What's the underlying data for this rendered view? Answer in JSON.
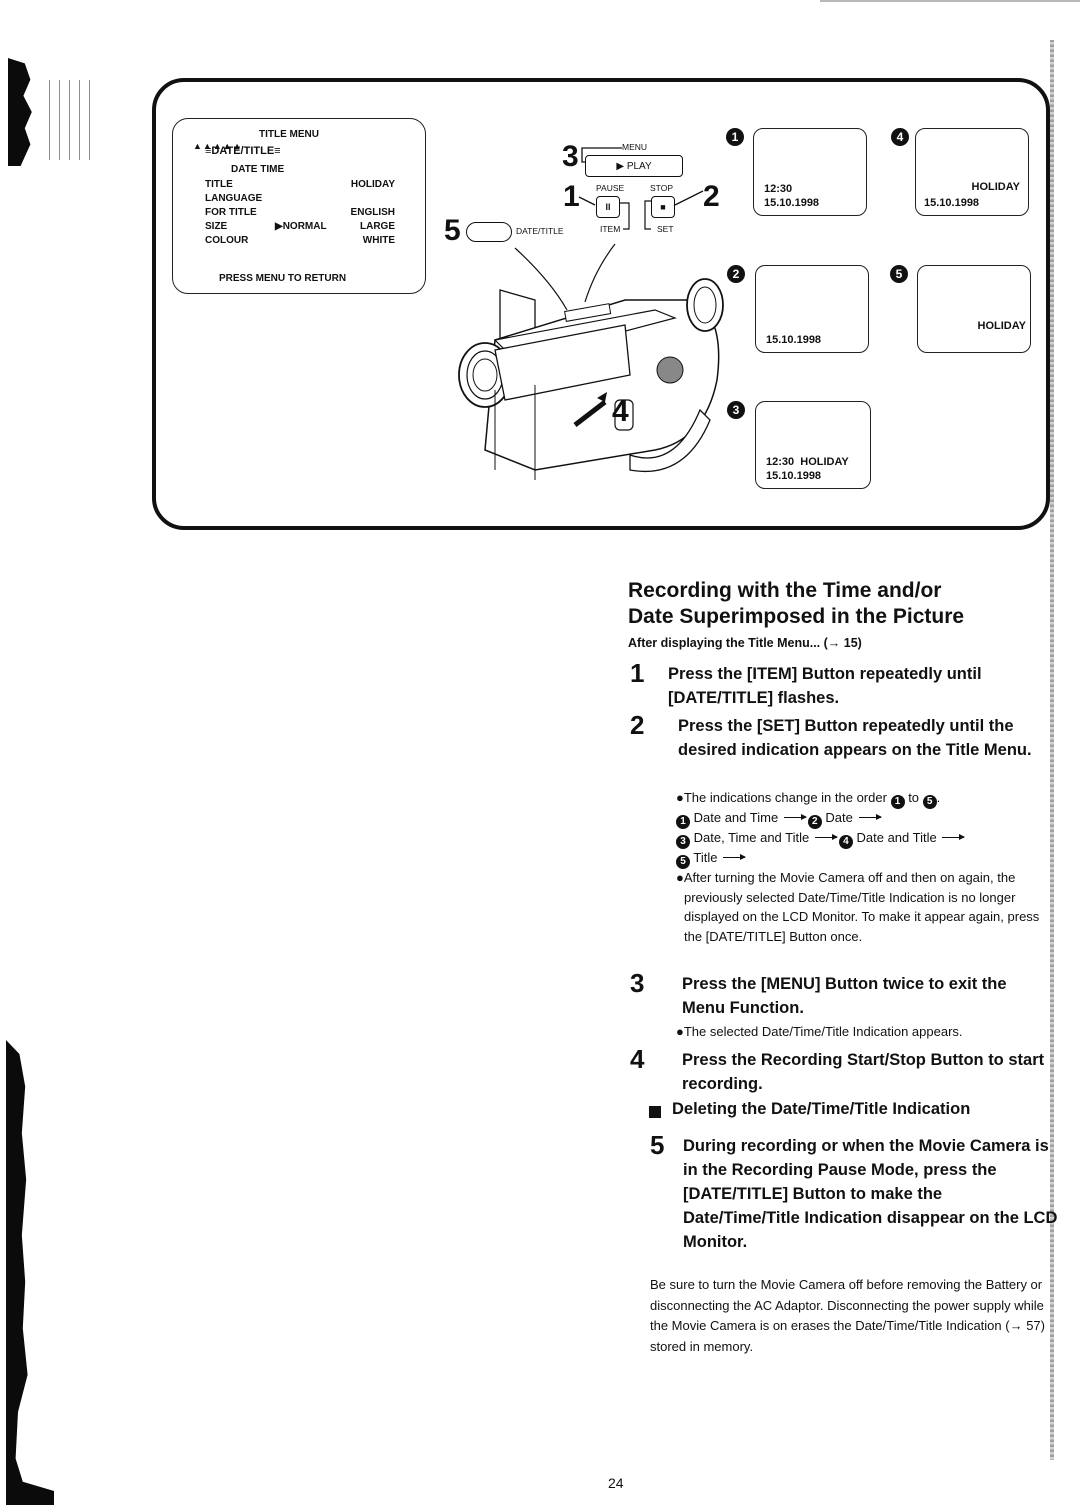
{
  "title_menu": {
    "title": "TITLE MENU",
    "flashing_item": "DATE/TITLE",
    "sub_item": "DATE TIME",
    "rows": [
      {
        "label": "TITLE",
        "middle": "",
        "value": "HOLIDAY"
      },
      {
        "label": "LANGUAGE",
        "middle": "",
        "value": ""
      },
      {
        "label": "FOR TITLE",
        "middle": "",
        "value": "ENGLISH"
      },
      {
        "label": "SIZE",
        "middle": "▶NORMAL",
        "value": "LARGE"
      },
      {
        "label": "COLOUR",
        "middle": "",
        "value": "WHITE"
      }
    ],
    "footer": "PRESS MENU TO RETURN"
  },
  "controls": {
    "callouts": [
      "3",
      "1",
      "2",
      "5",
      "4"
    ],
    "menu_label": "MENU",
    "play_label": "▶ PLAY",
    "pause_label": "PAUSE",
    "pause_glyph": "II",
    "stop_label": "STOP",
    "stop_glyph": "■",
    "item_label": "ITEM",
    "set_label": "SET",
    "date_title_label": "DATE/TITLE"
  },
  "lcd_screens": [
    {
      "num": "1",
      "line1": "12:30",
      "line2": "15.10.1998"
    },
    {
      "num": "2",
      "line1": "",
      "line2": "15.10.1998"
    },
    {
      "num": "3",
      "line1": "12:30  HOLIDAY",
      "line2": "15.10.1998"
    },
    {
      "num": "4",
      "line1": "HOLIDAY",
      "line2": "15.10.1998"
    },
    {
      "num": "5",
      "line1": "HOLIDAY",
      "line2": ""
    }
  ],
  "heading": {
    "line1": "Recording with the Time and/or",
    "line2": "Date Superimposed in the Picture",
    "subtitle": "After displaying the Title Menu... (→ 15)"
  },
  "steps": [
    {
      "num": "1",
      "text": "Press the [ITEM] Button repeatedly until [DATE/TITLE] flashes."
    },
    {
      "num": "2",
      "text": "Press the [SET] Button repeatedly until the desired indication appears on the Title Menu."
    },
    {
      "num": "3",
      "text": "Press the [MENU] Button twice to exit the Menu Function."
    },
    {
      "num": "4",
      "text": "Press the Recording Start/Stop Button to start recording."
    },
    {
      "num": "5",
      "text": "During recording or when the Movie Camera is in the Recording Pause Mode, press the [DATE/TITLE] Button to make the Date/Time/Title Indication disappear on the LCD Monitor."
    }
  ],
  "step2_notes": {
    "order_prefix": "●The indications change in the order",
    "order_to": "to",
    "order_from_num": "1",
    "order_to_num": "5",
    "sequence": [
      {
        "num": "1",
        "label": "Date and Time"
      },
      {
        "num": "2",
        "label": "Date"
      },
      {
        "num": "3",
        "label": "Date, Time and Title"
      },
      {
        "num": "4",
        "label": "Date and Title"
      },
      {
        "num": "5",
        "label": "Title"
      }
    ],
    "power_note": "●After turning the Movie Camera off and then on again, the previously selected Date/Time/Title Indication is no longer displayed on the LCD Monitor. To make it appear again, press the [DATE/TITLE] Button once."
  },
  "step3_note": "●The selected Date/Time/Title Indication appears.",
  "section_heading": "Deleting the Date/Time/Title Indication",
  "caution": "Be sure to turn the Movie Camera off before removing the Battery or disconnecting the AC Adaptor. Disconnecting the power supply while the Movie Camera is on erases the Date/Time/Title Indication (→ 57) stored in memory.",
  "page_number": "24"
}
